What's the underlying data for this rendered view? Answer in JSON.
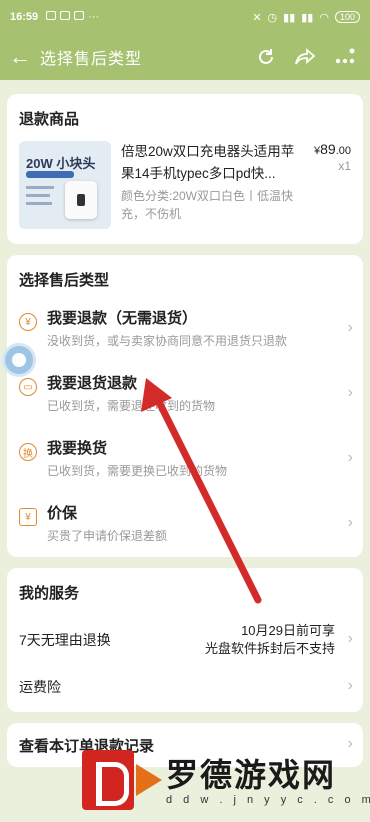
{
  "status_bar": {
    "time": "16:59",
    "battery": "100"
  },
  "nav": {
    "title": "选择售后类型"
  },
  "refund_item": {
    "section_title": "退款商品",
    "thumb_text": "20W 小块头",
    "name": "倍思20w双口充电器头适用苹果14手机typec多口pd快...",
    "variant": "颜色分类:20W双口白色丨低温快充，不伤机",
    "price_symbol": "¥",
    "price_int": "89",
    "price_dec": ".00",
    "quantity": "x1"
  },
  "aftersale": {
    "section_title": "选择售后类型",
    "options": [
      {
        "title": "我要退款（无需退货）",
        "desc": "没收到货，或与卖家协商同意不用退货只退款",
        "icon": "yuan-icon",
        "icon_glyph": "¥"
      },
      {
        "title": "我要退货退款",
        "desc": "已收到货，需要退还收到的货物",
        "icon": "package-icon",
        "icon_glyph": "▭"
      },
      {
        "title": "我要换货",
        "desc": "已收到货，需要更换已收到的货物",
        "icon": "exchange-icon",
        "icon_glyph": "换"
      },
      {
        "title": "价保",
        "desc": "买贵了申请价保退差额",
        "icon": "shield-yuan-icon",
        "icon_glyph": "¥"
      }
    ]
  },
  "services": {
    "section_title": "我的服务",
    "rows": [
      {
        "label": "7天无理由退换",
        "value_line1": "10月29日前可享",
        "value_line2": "光盘软件拆封后不支持"
      },
      {
        "label": "运费险",
        "value_line1": "",
        "value_line2": ""
      }
    ]
  },
  "records": {
    "label": "查看本订单退款记录"
  },
  "watermark": {
    "text": "罗德游戏网",
    "url": "d d w . j n y y c . c o m"
  },
  "colors": {
    "header": "#a6c271",
    "background": "#eaf0dc",
    "icon_accent": "#e08a2c",
    "arrow": "#d32a2a"
  }
}
